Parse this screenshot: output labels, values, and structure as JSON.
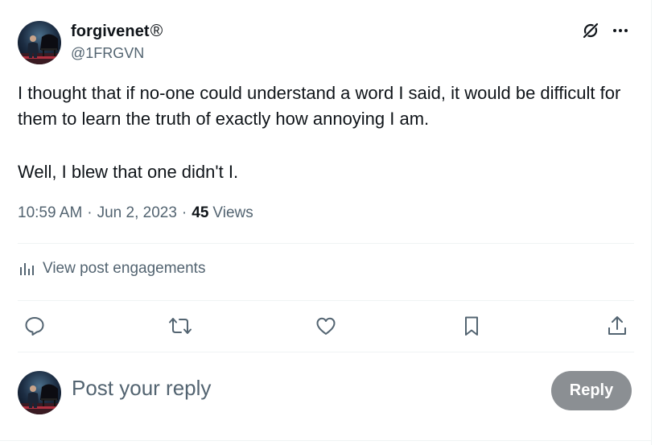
{
  "author": {
    "display_name": "forgivenet",
    "registered_mark": "®",
    "handle": "@1FRGVN"
  },
  "tweet": {
    "paragraph_1": "I thought that if no-one could understand a word I said, it would be difficult for them to learn the truth of exactly how annoying I am.",
    "paragraph_2": "Well, I blew that one didn't I."
  },
  "meta": {
    "time": "10:59 AM",
    "separator": "·",
    "date": "Jun 2, 2023",
    "views_count": "45",
    "views_label": "Views"
  },
  "engagements": {
    "label": "View post engagements"
  },
  "actions": {
    "icons": [
      "reply-icon",
      "retweet-icon",
      "like-icon",
      "bookmark-icon",
      "share-icon"
    ]
  },
  "reply": {
    "placeholder": "Post your reply",
    "button_label": "Reply"
  },
  "colors": {
    "text_primary": "#0f1419",
    "text_secondary": "#536471",
    "divider": "#eff3f4",
    "reply_button_disabled": "#8b8f93"
  }
}
